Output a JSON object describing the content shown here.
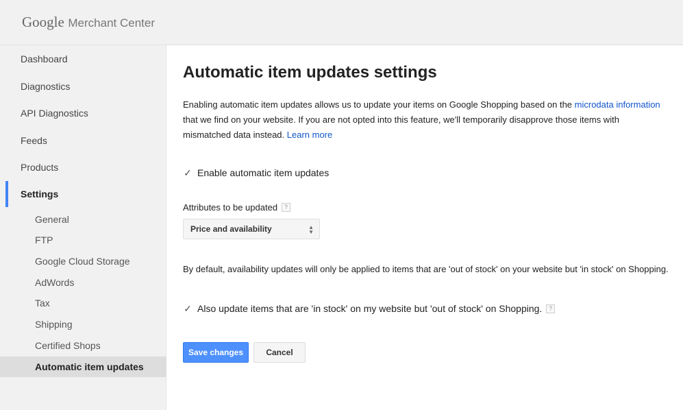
{
  "header": {
    "brand_google": "Google",
    "brand_product": "Merchant Center"
  },
  "sidebar": {
    "items": [
      {
        "label": "Dashboard"
      },
      {
        "label": "Diagnostics"
      },
      {
        "label": "API Diagnostics"
      },
      {
        "label": "Feeds"
      },
      {
        "label": "Products"
      },
      {
        "label": "Settings"
      }
    ],
    "settings_subitems": [
      {
        "label": "General"
      },
      {
        "label": "FTP"
      },
      {
        "label": "Google Cloud Storage"
      },
      {
        "label": "AdWords"
      },
      {
        "label": "Tax"
      },
      {
        "label": "Shipping"
      },
      {
        "label": "Certified Shops"
      },
      {
        "label": "Automatic item updates"
      }
    ],
    "accent_color": "#4285f4"
  },
  "main": {
    "title": "Automatic item updates settings",
    "description_part1": "Enabling automatic item updates allows us to update your items on Google Shopping based on the ",
    "description_link": "microdata information",
    "description_part2": " that we find on your website. If you are not opted into this feature, we'll temporarily disapprove those items with mismatched data instead. ",
    "learn_more": "Learn more",
    "enable_checkbox_label": "Enable automatic item updates",
    "enable_checked": true,
    "attributes_label": "Attributes to be updated",
    "help_glyph": "?",
    "attributes_select_value": "Price and availability",
    "default_text": "By default, availability updates will only be applied to items that are 'out of stock' on your website but 'in stock' on Shopping.",
    "also_update_label": "Also update items that are 'in stock' on my website but 'out of stock' on Shopping.",
    "also_update_checked": true,
    "save_label": "Save changes",
    "cancel_label": "Cancel",
    "link_color": "#1155cc",
    "primary_button_color": "#4d90fe"
  }
}
